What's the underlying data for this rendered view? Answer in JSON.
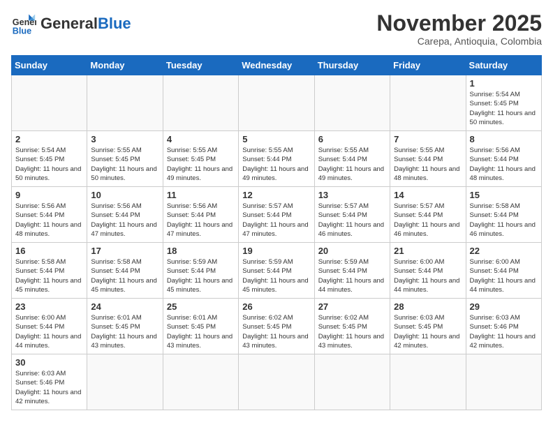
{
  "header": {
    "logo_general": "General",
    "logo_blue": "Blue",
    "month_title": "November 2025",
    "location": "Carepa, Antioquia, Colombia"
  },
  "weekdays": [
    "Sunday",
    "Monday",
    "Tuesday",
    "Wednesday",
    "Thursday",
    "Friday",
    "Saturday"
  ],
  "days": {
    "1": {
      "sunrise": "5:54 AM",
      "sunset": "5:45 PM",
      "daylight": "11 hours and 50 minutes."
    },
    "2": {
      "sunrise": "5:54 AM",
      "sunset": "5:45 PM",
      "daylight": "11 hours and 50 minutes."
    },
    "3": {
      "sunrise": "5:55 AM",
      "sunset": "5:45 PM",
      "daylight": "11 hours and 50 minutes."
    },
    "4": {
      "sunrise": "5:55 AM",
      "sunset": "5:45 PM",
      "daylight": "11 hours and 49 minutes."
    },
    "5": {
      "sunrise": "5:55 AM",
      "sunset": "5:44 PM",
      "daylight": "11 hours and 49 minutes."
    },
    "6": {
      "sunrise": "5:55 AM",
      "sunset": "5:44 PM",
      "daylight": "11 hours and 49 minutes."
    },
    "7": {
      "sunrise": "5:55 AM",
      "sunset": "5:44 PM",
      "daylight": "11 hours and 48 minutes."
    },
    "8": {
      "sunrise": "5:56 AM",
      "sunset": "5:44 PM",
      "daylight": "11 hours and 48 minutes."
    },
    "9": {
      "sunrise": "5:56 AM",
      "sunset": "5:44 PM",
      "daylight": "11 hours and 48 minutes."
    },
    "10": {
      "sunrise": "5:56 AM",
      "sunset": "5:44 PM",
      "daylight": "11 hours and 47 minutes."
    },
    "11": {
      "sunrise": "5:56 AM",
      "sunset": "5:44 PM",
      "daylight": "11 hours and 47 minutes."
    },
    "12": {
      "sunrise": "5:57 AM",
      "sunset": "5:44 PM",
      "daylight": "11 hours and 47 minutes."
    },
    "13": {
      "sunrise": "5:57 AM",
      "sunset": "5:44 PM",
      "daylight": "11 hours and 46 minutes."
    },
    "14": {
      "sunrise": "5:57 AM",
      "sunset": "5:44 PM",
      "daylight": "11 hours and 46 minutes."
    },
    "15": {
      "sunrise": "5:58 AM",
      "sunset": "5:44 PM",
      "daylight": "11 hours and 46 minutes."
    },
    "16": {
      "sunrise": "5:58 AM",
      "sunset": "5:44 PM",
      "daylight": "11 hours and 45 minutes."
    },
    "17": {
      "sunrise": "5:58 AM",
      "sunset": "5:44 PM",
      "daylight": "11 hours and 45 minutes."
    },
    "18": {
      "sunrise": "5:59 AM",
      "sunset": "5:44 PM",
      "daylight": "11 hours and 45 minutes."
    },
    "19": {
      "sunrise": "5:59 AM",
      "sunset": "5:44 PM",
      "daylight": "11 hours and 45 minutes."
    },
    "20": {
      "sunrise": "5:59 AM",
      "sunset": "5:44 PM",
      "daylight": "11 hours and 44 minutes."
    },
    "21": {
      "sunrise": "6:00 AM",
      "sunset": "5:44 PM",
      "daylight": "11 hours and 44 minutes."
    },
    "22": {
      "sunrise": "6:00 AM",
      "sunset": "5:44 PM",
      "daylight": "11 hours and 44 minutes."
    },
    "23": {
      "sunrise": "6:00 AM",
      "sunset": "5:44 PM",
      "daylight": "11 hours and 44 minutes."
    },
    "24": {
      "sunrise": "6:01 AM",
      "sunset": "5:45 PM",
      "daylight": "11 hours and 43 minutes."
    },
    "25": {
      "sunrise": "6:01 AM",
      "sunset": "5:45 PM",
      "daylight": "11 hours and 43 minutes."
    },
    "26": {
      "sunrise": "6:02 AM",
      "sunset": "5:45 PM",
      "daylight": "11 hours and 43 minutes."
    },
    "27": {
      "sunrise": "6:02 AM",
      "sunset": "5:45 PM",
      "daylight": "11 hours and 43 minutes."
    },
    "28": {
      "sunrise": "6:03 AM",
      "sunset": "5:45 PM",
      "daylight": "11 hours and 42 minutes."
    },
    "29": {
      "sunrise": "6:03 AM",
      "sunset": "5:46 PM",
      "daylight": "11 hours and 42 minutes."
    },
    "30": {
      "sunrise": "6:03 AM",
      "sunset": "5:46 PM",
      "daylight": "11 hours and 42 minutes."
    }
  }
}
